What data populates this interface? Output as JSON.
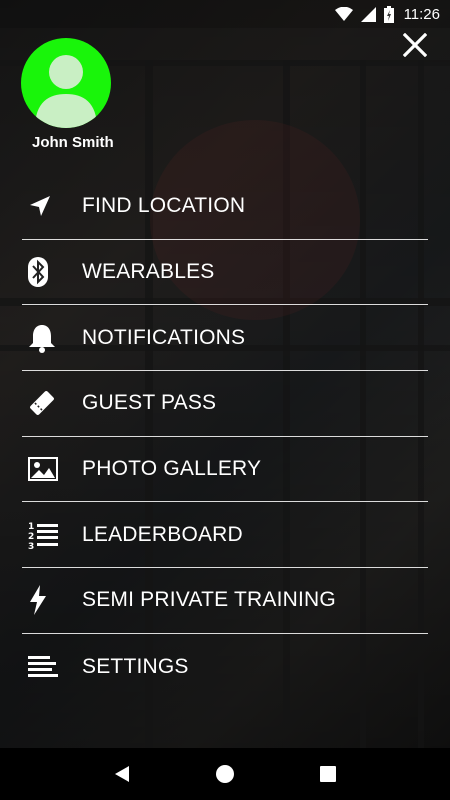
{
  "status_bar": {
    "time": "11:26",
    "icons": [
      "wifi-icon",
      "signal-icon",
      "battery-charging-icon"
    ]
  },
  "drawer": {
    "close_icon": "close-icon",
    "avatar_icon": "user-avatar-icon",
    "avatar_color": "#19f50a",
    "user_name": "John Smith",
    "menu": [
      {
        "label": "FIND LOCATION",
        "icon": "navigation-arrow-icon"
      },
      {
        "label": "WEARABLES",
        "icon": "bluetooth-icon"
      },
      {
        "label": "NOTIFICATIONS",
        "icon": "bell-icon"
      },
      {
        "label": "GUEST PASS",
        "icon": "ticket-icon"
      },
      {
        "label": "PHOTO GALLERY",
        "icon": "image-icon"
      },
      {
        "label": "LEADERBOARD",
        "icon": "numbered-list-icon"
      },
      {
        "label": "SEMI PRIVATE TRAINING",
        "icon": "lightning-icon"
      },
      {
        "label": "SETTINGS",
        "icon": "settings-lines-icon"
      }
    ]
  },
  "nav_bar": {
    "buttons": [
      "back-icon",
      "home-icon",
      "recents-icon"
    ]
  }
}
